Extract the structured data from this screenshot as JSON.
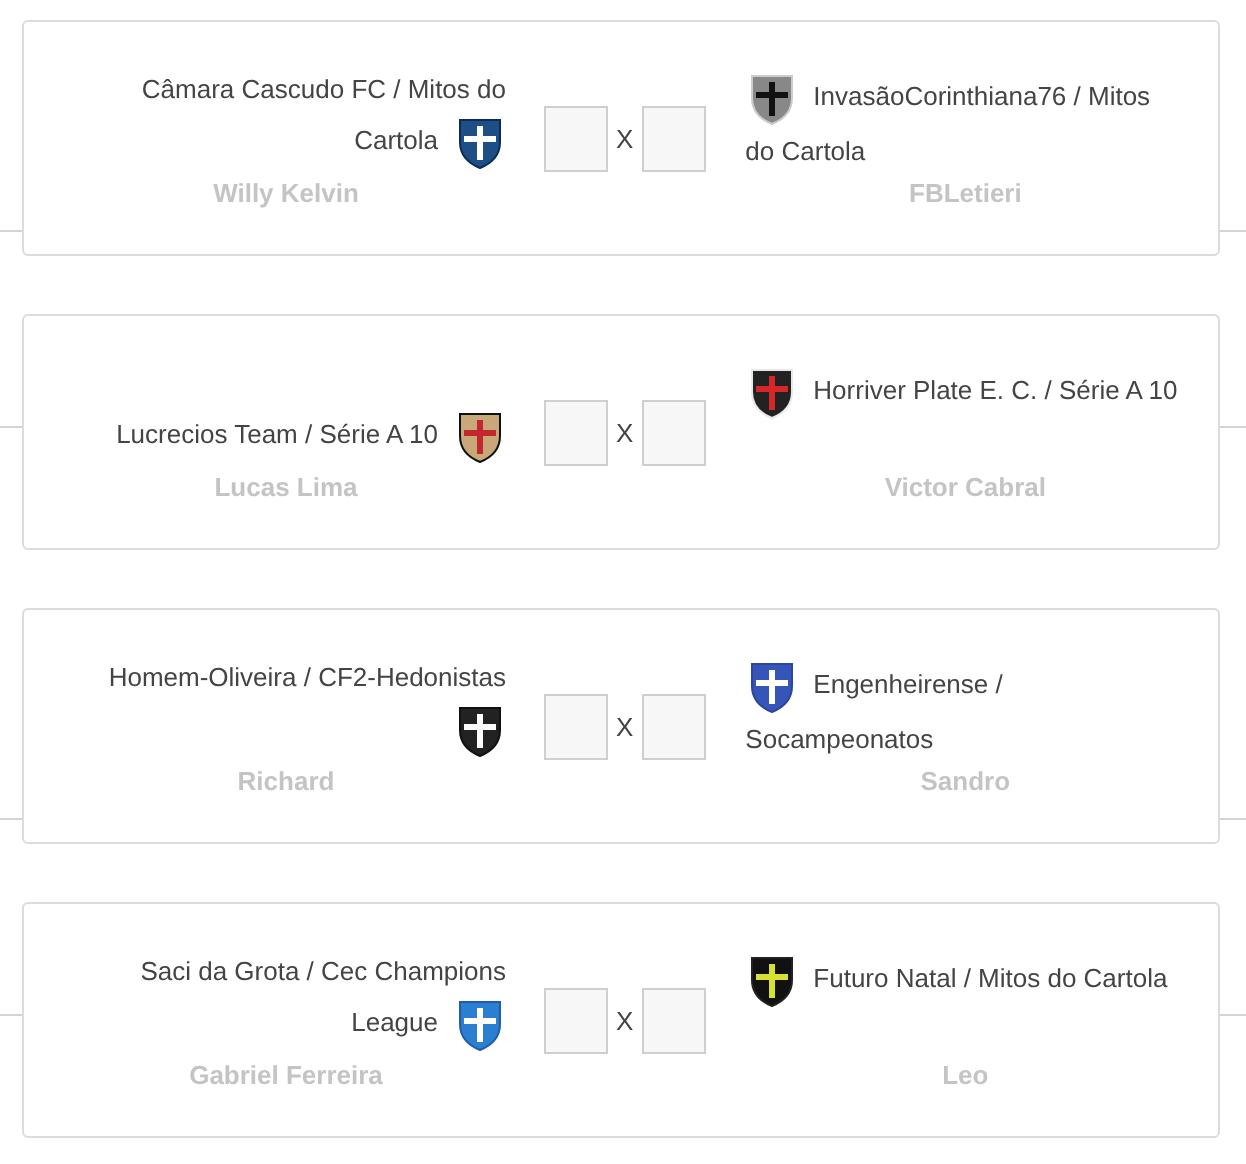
{
  "matches": [
    {
      "home": {
        "team": "Câmara Cascudo FC / Mitos do Cartola",
        "owner": "Willy Kelvin"
      },
      "separator": "X",
      "away": {
        "team": "InvasãoCorinthiana76 / Mitos do Cartola",
        "owner": "FBLetieri"
      }
    },
    {
      "home": {
        "team": "Lucrecios Team / Série A 10",
        "owner": "Lucas Lima"
      },
      "separator": "X",
      "away": {
        "team": "Horriver Plate E. C. / Série A 10",
        "owner": "Victor Cabral"
      }
    },
    {
      "home": {
        "team": "Homem-Oliveira / CF2-Hedonistas",
        "owner": "Richard"
      },
      "separator": "X",
      "away": {
        "team": "Engenheirense / Socampeonatos",
        "owner": "Sandro"
      }
    },
    {
      "home": {
        "team": "Saci da Grota / Cec Champions League",
        "owner": "Gabriel Ferreira"
      },
      "separator": "X",
      "away": {
        "team": "Futuro Natal / Mitos do Cartola",
        "owner": "Leo"
      }
    }
  ]
}
